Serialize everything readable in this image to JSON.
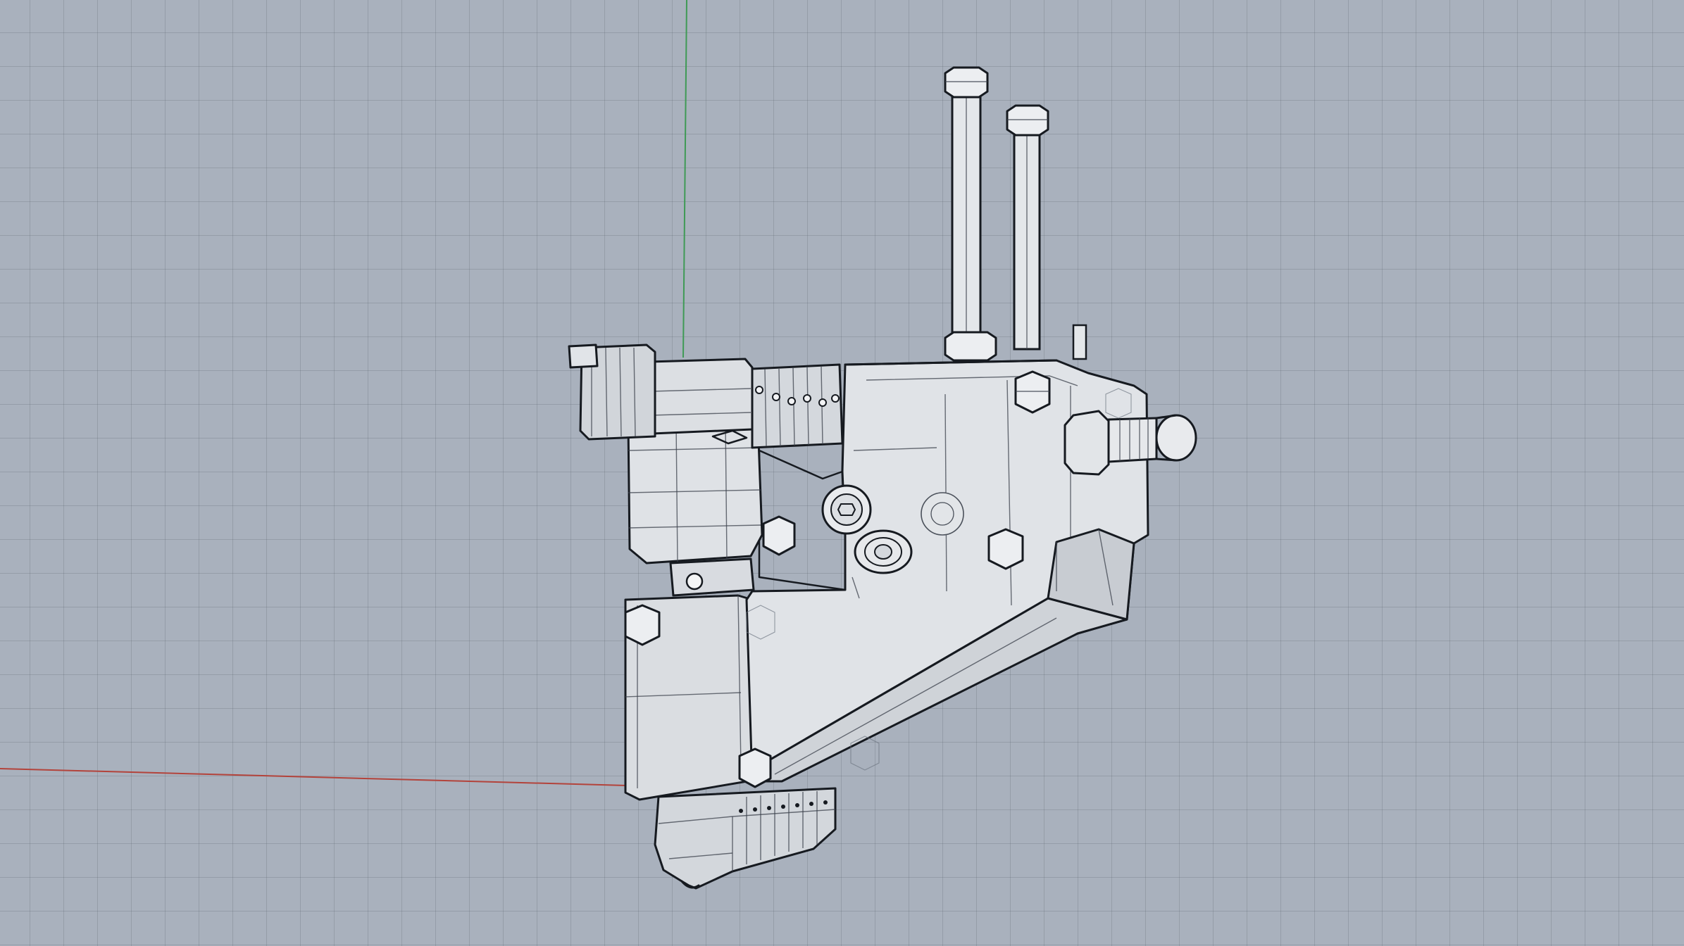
{
  "viewport": {
    "view": "Perspective",
    "display_mode": "wireframe-ghosted",
    "background_color": "#a9b1bd",
    "grid_color": "#7b8594",
    "axis_x_color": "#b3433b",
    "axis_y_color": "#3f9a55"
  },
  "model": {
    "icon": "extruder-hotend-assembly-icon",
    "body_color": "#dde0e4",
    "edge_color": "#161a20"
  }
}
